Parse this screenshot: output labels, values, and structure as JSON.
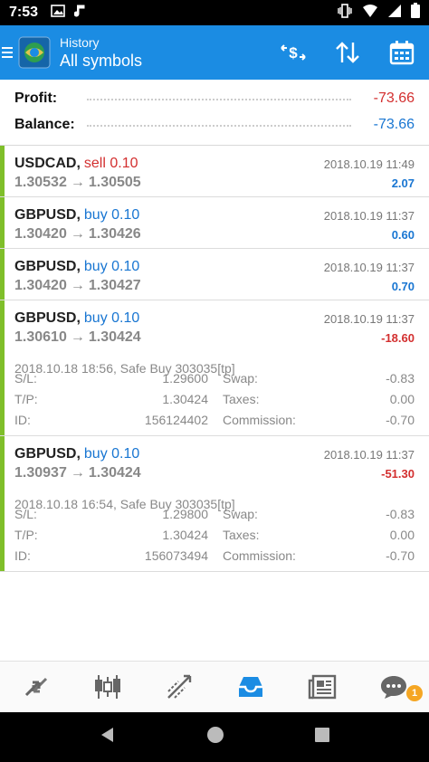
{
  "statusbar": {
    "time": "7:53"
  },
  "appbar": {
    "title": "History",
    "subtitle": "All symbols"
  },
  "summary": {
    "profit_label": "Profit:",
    "profit_value": "-73.66",
    "balance_label": "Balance:",
    "balance_value": "-73.66"
  },
  "deals": [
    {
      "symbol": "USDCAD,",
      "side": "sell 0.10",
      "side_color": "#d32f2f",
      "time": "2018.10.19 11:49",
      "open": "1.30532",
      "close": "1.30505",
      "profit": "2.07",
      "profit_color": "#1976d2"
    },
    {
      "symbol": "GBPUSD,",
      "side": "buy 0.10",
      "side_color": "#1976d2",
      "time": "2018.10.19 11:37",
      "open": "1.30420",
      "close": "1.30426",
      "profit": "0.60",
      "profit_color": "#1976d2"
    },
    {
      "symbol": "GBPUSD,",
      "side": "buy 0.10",
      "side_color": "#1976d2",
      "time": "2018.10.19 11:37",
      "open": "1.30420",
      "close": "1.30427",
      "profit": "0.70",
      "profit_color": "#1976d2"
    },
    {
      "symbol": "GBPUSD,",
      "side": "buy 0.10",
      "side_color": "#1976d2",
      "time": "2018.10.19 11:37",
      "open": "1.30610",
      "close": "1.30424",
      "profit": "-18.60",
      "profit_color": "#d32f2f",
      "comment": "2018.10.18 18:56, Safe Buy 303035[tp]",
      "sl_label": "S/L:",
      "sl": "1.29600",
      "swap_label": "Swap:",
      "swap": "-0.83",
      "tp_label": "T/P:",
      "tp": "1.30424",
      "taxes_label": "Taxes:",
      "taxes": "0.00",
      "id_label": "ID:",
      "id": "156124402",
      "commission_label": "Commission:",
      "commission": "-0.70"
    },
    {
      "symbol": "GBPUSD,",
      "side": "buy 0.10",
      "side_color": "#1976d2",
      "time": "2018.10.19 11:37",
      "open": "1.30937",
      "close": "1.30424",
      "profit": "-51.30",
      "profit_color": "#d32f2f",
      "comment": "2018.10.18 16:54, Safe Buy 303035[tp]",
      "sl_label": "S/L:",
      "sl": "1.29800",
      "swap_label": "Swap:",
      "swap": "-0.83",
      "tp_label": "T/P:",
      "tp": "1.30424",
      "taxes_label": "Taxes:",
      "taxes": "0.00",
      "id_label": "ID:",
      "id": "156073494",
      "commission_label": "Commission:",
      "commission": "-0.70"
    }
  ],
  "bottomnav": {
    "items": [
      "quotes-icon",
      "chart-icon",
      "trade-icon",
      "history-icon",
      "news-icon",
      "chat-icon"
    ],
    "active_index": 3,
    "chat_badge": "1"
  },
  "colors": {
    "accent": "#1b8ce3",
    "sell": "#d32f2f",
    "buy": "#1976d2",
    "deal_bar": "#7fbf2a",
    "badge": "#f5a623"
  }
}
